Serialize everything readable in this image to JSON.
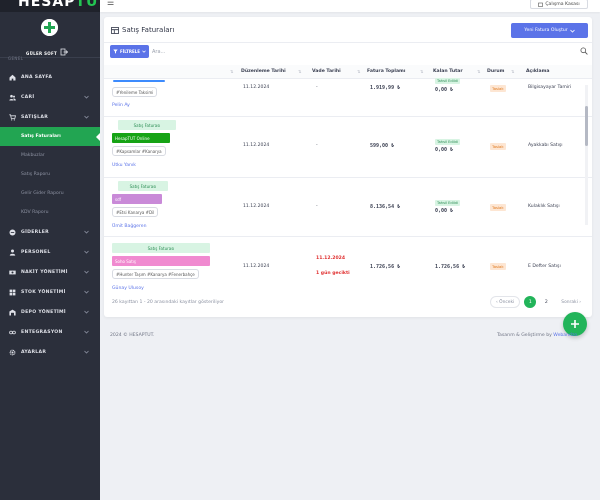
{
  "app": {
    "logo_main": "HESAP",
    "logo_accent": "TUT"
  },
  "user": {
    "name": "GÜLER SOFT"
  },
  "sidebar": {
    "section_label": "GENEL",
    "items": [
      {
        "label": "ANA SAYFA",
        "icon": "home-icon"
      },
      {
        "label": "CARİ",
        "icon": "users-icon"
      },
      {
        "label": "SATIŞLAR",
        "icon": "cart-icon"
      },
      {
        "label": "GİDERLER",
        "icon": "minus-circle-icon"
      },
      {
        "label": "PERSONEL",
        "icon": "person-icon"
      },
      {
        "label": "NAKİT YÖNETİMİ",
        "icon": "cash-icon"
      },
      {
        "label": "STOK YÖNETİMİ",
        "icon": "box-icon"
      },
      {
        "label": "DEPO YÖNETİMİ",
        "icon": "warehouse-icon"
      },
      {
        "label": "ENTEGRASYON",
        "icon": "link-icon"
      },
      {
        "label": "AYARLAR",
        "icon": "gear-icon"
      }
    ],
    "sales_sub": [
      {
        "label": "Satış Faturaları",
        "active": true
      },
      {
        "label": "Makbuzlar"
      },
      {
        "label": "Satış Raporu"
      },
      {
        "label": "Gelir Gider Raporu"
      },
      {
        "label": "KDV Raporu"
      }
    ]
  },
  "topbar": {
    "menu_button": "Çalışma Kasası"
  },
  "page": {
    "title": "Satış Faturaları",
    "new_button": "Yeni Fatura Oluştur",
    "filter_button": "FİLTRELE",
    "search_placeholder": "Ara..."
  },
  "table": {
    "headers": [
      "Düzenleme Tarihi",
      "Vade Tarihi",
      "Fatura Toplamı",
      "Kalan Tutar",
      "Durum",
      "Açıklama"
    ],
    "rows": [
      {
        "tags": "#Yenileme Taksimi",
        "customer": "Pelin Ay",
        "date": "11.12.2024",
        "due": "-",
        "total": "1.919,99 ₺",
        "remaining": "0,00 ₺",
        "paid": "Tahsil Edildi",
        "status": "Taslak",
        "desc": "Bilgisayayar Tamiri"
      },
      {
        "type": "Satış Faturası",
        "tag": "HesapTUT Online",
        "tag_color": "#16a315",
        "tags": "#Kapsamlar #Kanarya",
        "customer": "Utku Yanık",
        "date": "11.12.2024",
        "due": "-",
        "total": "599,00 ₺",
        "remaining": "0,00 ₺",
        "paid": "Tahsil Edildi",
        "status": "Taslak",
        "desc": "Ayakkabı Satışı"
      },
      {
        "type": "Satış Faturası",
        "tag": "sdf",
        "tag_color": "#c98ad8",
        "tags": "#Etsi Kanarya #Dil",
        "customer": "Ümit Bağgeren",
        "date": "11.12.2024",
        "due": "-",
        "total": "8.136,54 ₺",
        "remaining": "0,00 ₺",
        "paid": "Tahsil Edildi",
        "status": "Taslak",
        "desc": "Kulaklık Satışı"
      },
      {
        "type": "Satış Faturası",
        "tag": "Soho Satış",
        "tag_color": "#f08ad0",
        "tags": "#Hunter Taşım #Kanarya #Fenerbahçe",
        "customer": "Günay Ulusoy",
        "date": "11.12.2024",
        "due": "11.12.2024",
        "overdue": "1 gün gecikti",
        "total": "1.726,56 ₺",
        "remaining": "1.726,56 ₺",
        "status": "Taslak",
        "desc": "E Defter Satışı"
      }
    ]
  },
  "pagination": {
    "info": "26 kayıttan 1 - 20 arasındaki kayıtlar gösteriliyor",
    "prev": "Önceki",
    "pages": [
      "1",
      "2"
    ],
    "next": "Sonraki"
  },
  "footer": {
    "left": "2024 © HESAPTUT.",
    "right_prefix": "Tasarım & Geliştirme by ",
    "right_brand": "Webandzo"
  },
  "colors": {
    "primary": "#5b73e8",
    "success": "#22b45a",
    "sidebar": "#2b2f3b"
  }
}
